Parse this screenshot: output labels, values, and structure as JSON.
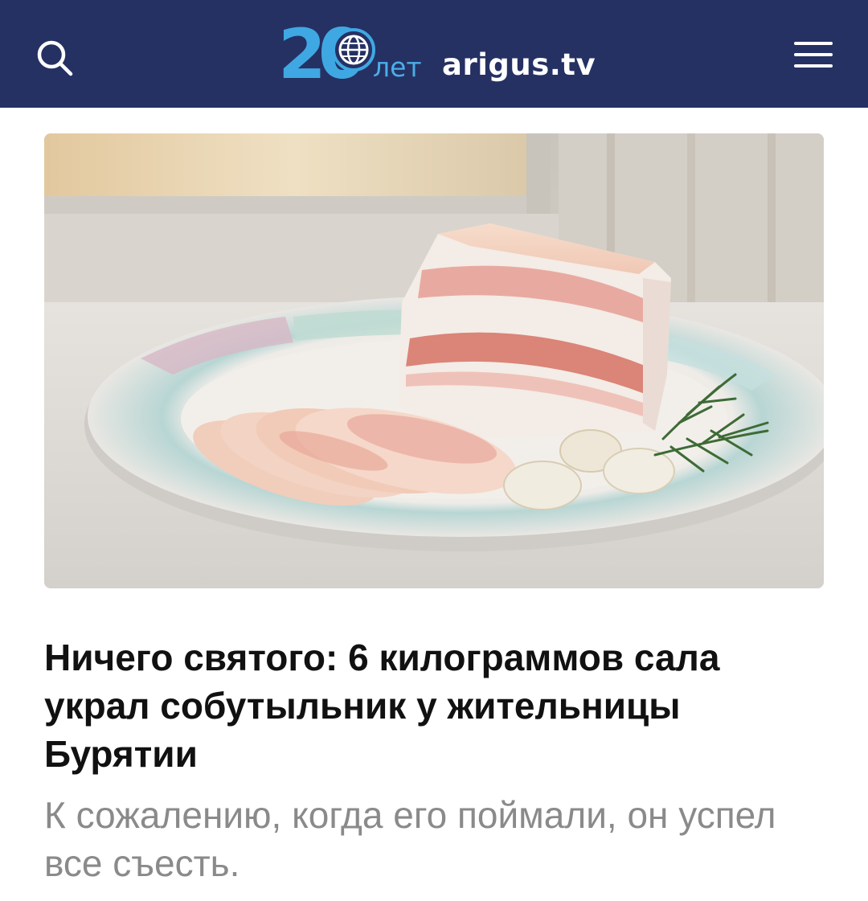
{
  "header": {
    "logo": {
      "number": "20",
      "years": "лет",
      "site": "arigus.tv"
    },
    "search_icon": "search-icon",
    "menu_icon": "hamburger-menu-icon",
    "background": "#253163",
    "accent": "#3fa8e3"
  },
  "article": {
    "image": "sliced-salo-on-plate-photo",
    "title": "Ничего святого: 6 килограммов сала украл собутыльник у жительницы Бурятии",
    "lead": "К сожалению, когда его поймали, он успел все съесть."
  }
}
